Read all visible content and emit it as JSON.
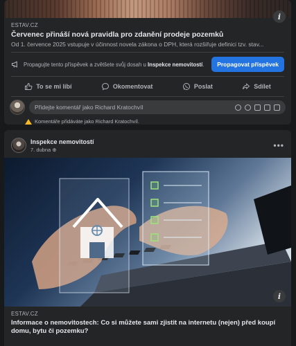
{
  "post1": {
    "link_domain": "ESTAV.CZ",
    "link_title": "Červenec přináší nová pravidla pro zdanění prodeje pozemků",
    "link_desc": "Od 1. července 2025 vstupuje v účinnost novela zákona o DPH, která rozšiřuje definici tzv. stav...",
    "info": "i",
    "promote_text_pre": "Propagujte tento příspěvek a zvětšete svůj dosah u ",
    "promote_page": "Inspekce nemovitostí",
    "promote_text_post": ".",
    "promote_button": "Propagovat příspěvek",
    "actions": {
      "like": "To se mi líbí",
      "comment": "Okomentovat",
      "send": "Poslat",
      "share": "Sdílet"
    },
    "comment_placeholder": "Přidejte komentář jako Richard Kratochvíl",
    "comment_notice": "Komentáře přidáváte jako Richard Kratochvíl."
  },
  "post2": {
    "page_name": "Inspekce nemovitostí",
    "date": "7. dubna",
    "more": "•••",
    "info": "i",
    "link_domain": "ESTAV.CZ",
    "link_title": "Informace o nemovitostech: Co si můžete sami zjistit na internetu (nejen) před koupí domu, bytu či pozemku?"
  },
  "colors": {
    "background": "#18191a",
    "card": "#242526",
    "primary_button": "#2374e1",
    "text_primary": "#e4e6eb",
    "text_secondary": "#b0b3b8",
    "warning": "#f7b928"
  }
}
